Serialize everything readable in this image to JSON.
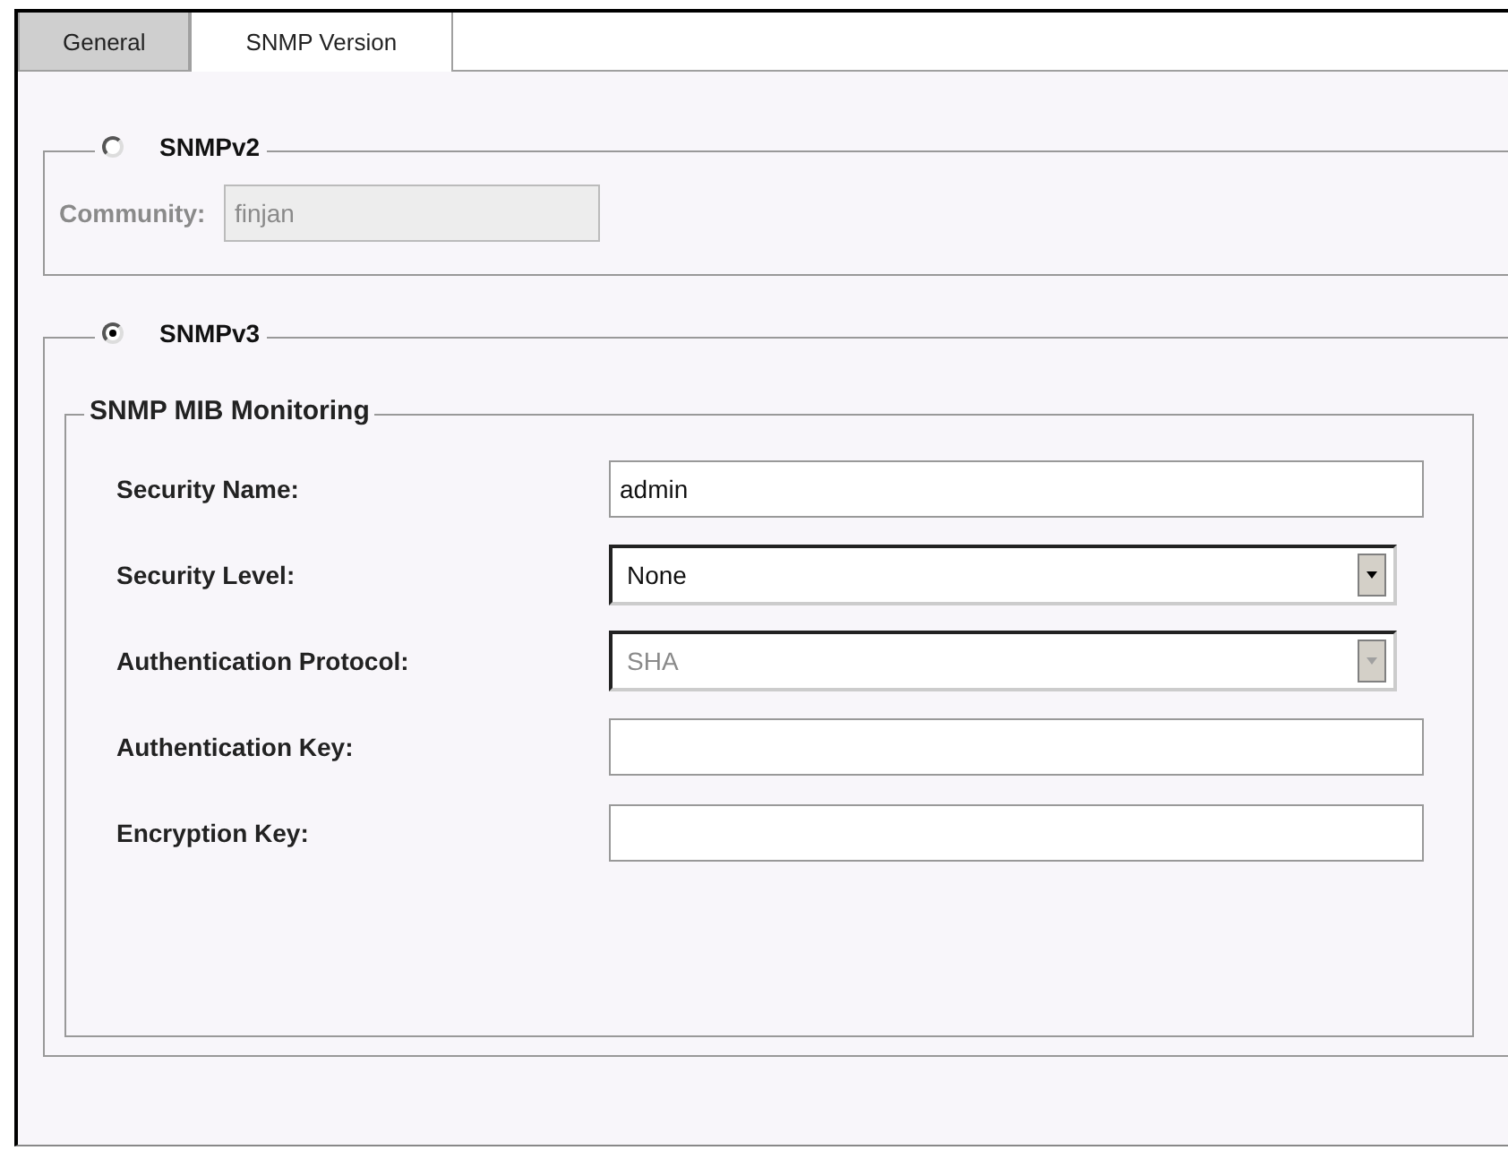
{
  "tabs": [
    {
      "label": "General",
      "selected": false
    },
    {
      "label": "SNMP Version",
      "selected": true
    }
  ],
  "snmpv2": {
    "label": "SNMPv2",
    "selected": false,
    "fields": [
      {
        "kind": "text",
        "label": "Community:",
        "value": "finjan",
        "disabled": true
      }
    ]
  },
  "snmpv3": {
    "label": "SNMPv3",
    "selected": true,
    "group": {
      "title": "SNMP MIB Monitoring",
      "fields": [
        {
          "kind": "text",
          "label": "Security Name:",
          "value": "admin",
          "disabled": false
        },
        {
          "kind": "select",
          "label": "Security Level:",
          "value": "None",
          "disabled": false
        },
        {
          "kind": "select",
          "label": "Authentication Protocol:",
          "value": "SHA",
          "disabled": true
        },
        {
          "kind": "text",
          "label": "Authentication Key:",
          "disabled": false
        },
        {
          "kind": "text",
          "label": "Encryption Key:",
          "disabled": false
        }
      ]
    }
  }
}
